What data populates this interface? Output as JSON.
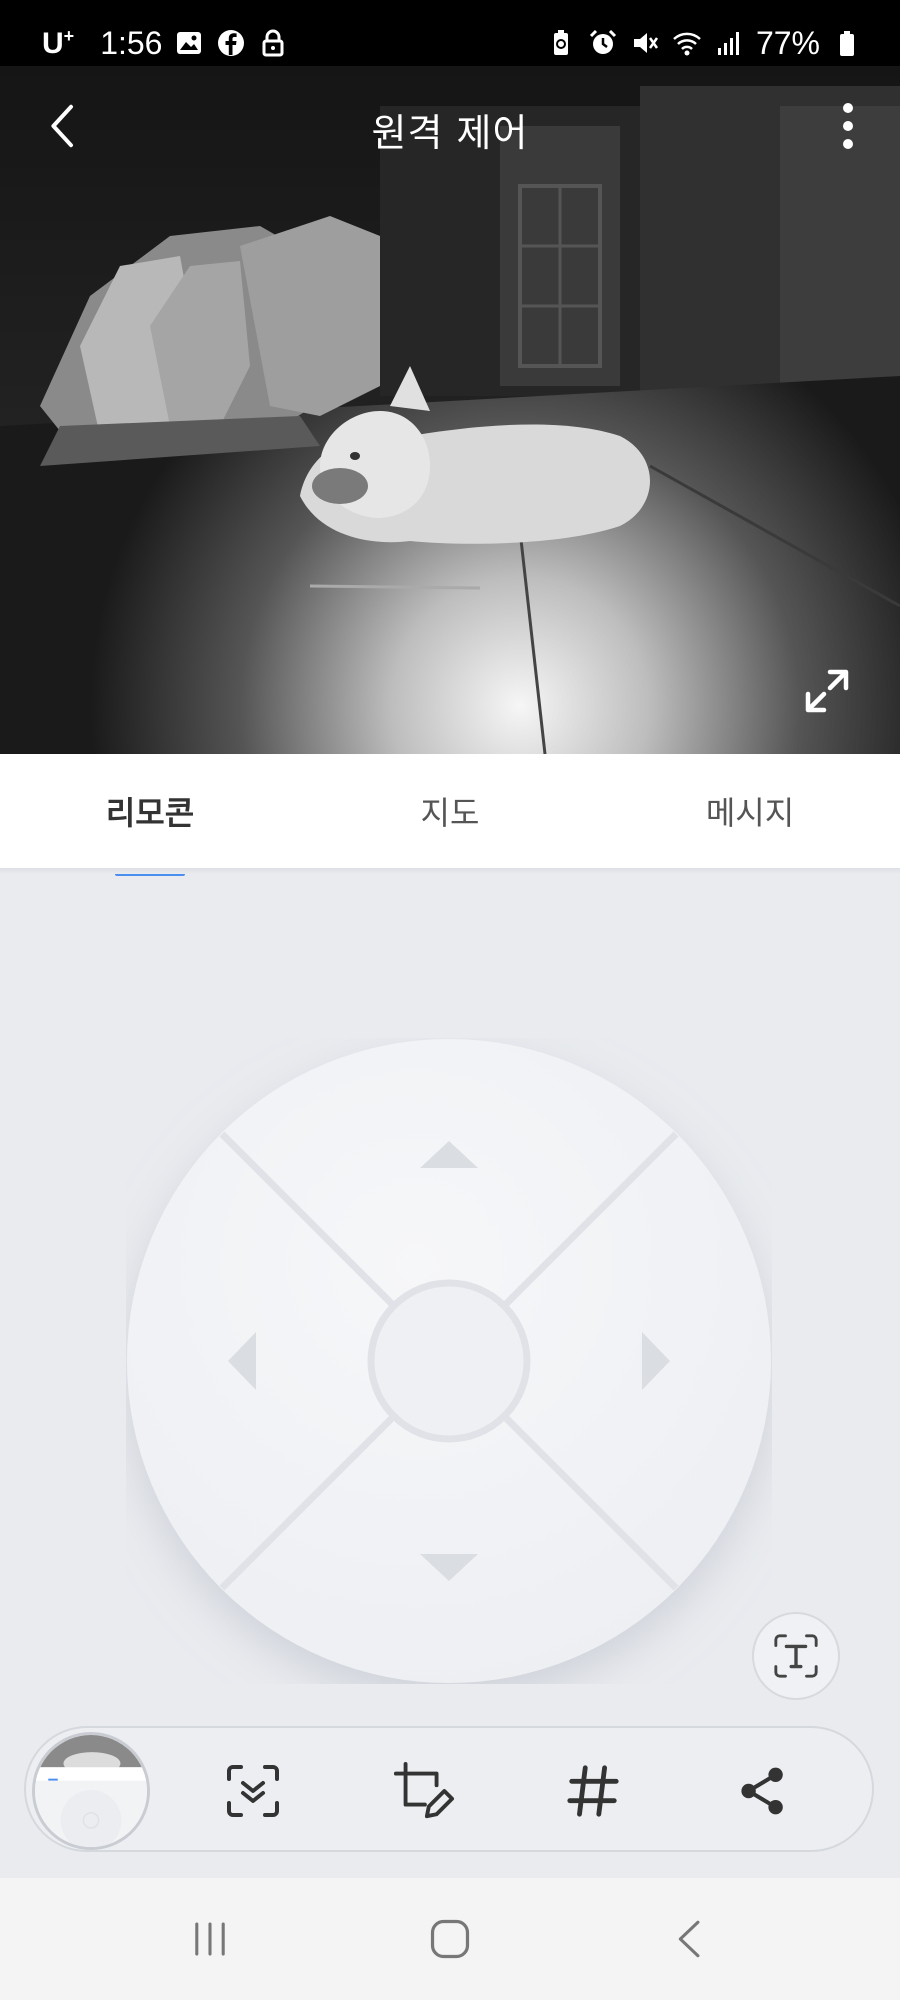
{
  "status_bar": {
    "carrier": "U",
    "carrier_sup": "+",
    "time": "1:56",
    "battery": "77%",
    "left_icons": [
      "gallery-icon",
      "facebook-icon",
      "lock-icon"
    ],
    "right_icons": [
      "battery-saver-icon",
      "alarm-icon",
      "mute-icon",
      "wifi-icon",
      "signal-icon",
      "battery-icon"
    ]
  },
  "header": {
    "title": "원격 제어",
    "back_icon": "chevron-left-icon",
    "more_icon": "more-vertical-icon",
    "fullscreen_icon": "expand-icon"
  },
  "tabs": [
    {
      "label": "리모콘",
      "active": true
    },
    {
      "label": "지도",
      "active": false
    },
    {
      "label": "메시지",
      "active": false
    }
  ],
  "accent_color": "#4a8ef0",
  "remote": {
    "directions": [
      "up",
      "down",
      "left",
      "right"
    ],
    "text_button_icon": "text-recognition-icon"
  },
  "toolbar": {
    "items": [
      "scan-icon",
      "edit-crop-icon",
      "hashtag-icon",
      "share-icon"
    ]
  },
  "navbar": {
    "items": [
      "recent-apps-icon",
      "home-icon",
      "back-icon"
    ]
  }
}
